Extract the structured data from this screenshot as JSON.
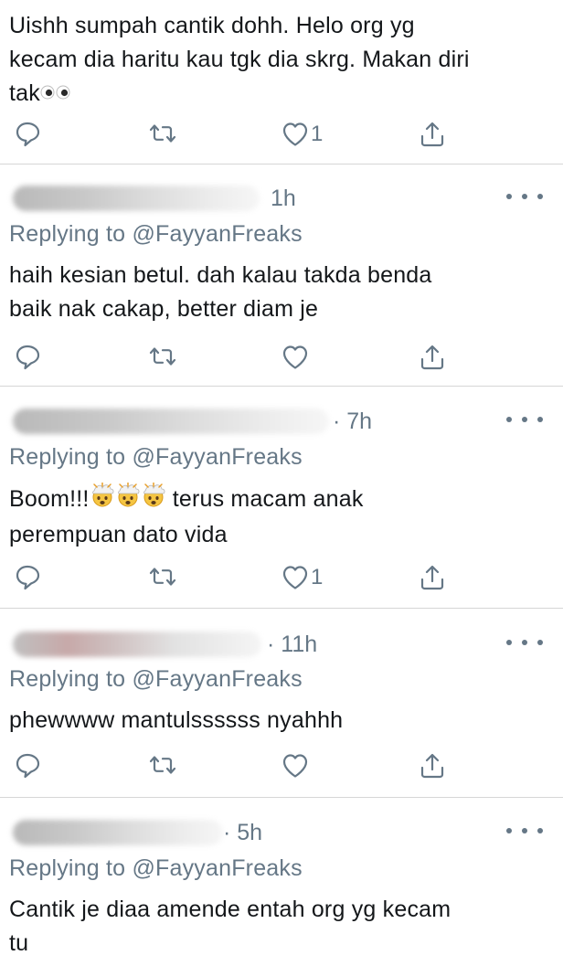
{
  "tweets": [
    {
      "text_lines": [
        "Uishh sumpah cantik dohh. Helo org yg",
        "kecam dia haritu kau tgk dia skrg. Makan diri",
        "tak"
      ],
      "likes": "1"
    },
    {
      "time": "1h",
      "replying_prefix": "Replying to",
      "replying_handle": "@FayyanFreaks",
      "text_lines": [
        "haih kesian betul. dah kalau takda benda",
        "baik nak cakap, better diam je"
      ],
      "likes": ""
    },
    {
      "time": "· 7h",
      "replying_prefix": "Replying to",
      "replying_handle": "@FayyanFreaks",
      "text_lines": [
        "Boom!!!",
        "terus macam anak",
        "perempuan dato vida"
      ],
      "likes": "1"
    },
    {
      "time": "· 11h",
      "replying_prefix": "Replying to",
      "replying_handle": "@FayyanFreaks",
      "text_lines": [
        "phewwww mantulssssss nyahhh"
      ],
      "likes": ""
    },
    {
      "time": "· 5h",
      "replying_prefix": "Replying to",
      "replying_handle": "@FayyanFreaks",
      "text_lines": [
        "Cantik je diaa amende entah org yg kecam",
        "tu"
      ]
    }
  ],
  "icons": {
    "reply": "reply-icon",
    "retweet": "retweet-icon",
    "like": "heart-icon",
    "share": "share-icon",
    "more": "more-options-icon"
  },
  "colors": {
    "text": "#14171a",
    "secondary": "#657786",
    "divider": "#d6d6d6"
  }
}
